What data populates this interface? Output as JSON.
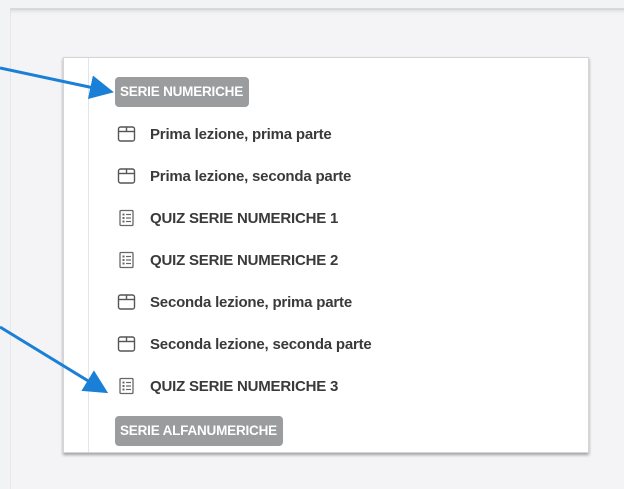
{
  "sections": [
    {
      "label": "SERIE NUMERICHE"
    },
    {
      "label": "SERIE ALFANUMERICHE"
    }
  ],
  "items": [
    {
      "label": "Prima lezione, prima parte",
      "icon": "lesson-icon"
    },
    {
      "label": "Prima lezione, seconda parte",
      "icon": "lesson-icon"
    },
    {
      "label": "QUIZ SERIE NUMERICHE 1",
      "icon": "quiz-icon"
    },
    {
      "label": "QUIZ SERIE NUMERICHE 2",
      "icon": "quiz-icon"
    },
    {
      "label": "Seconda lezione, prima parte",
      "icon": "lesson-icon"
    },
    {
      "label": "Seconda lezione, seconda parte",
      "icon": "lesson-icon"
    },
    {
      "label": "QUIZ SERIE NUMERICHE 3",
      "icon": "quiz-icon"
    }
  ],
  "colors": {
    "arrow": "#1a7fd6",
    "section_bg": "#9b9c9e",
    "item_text": "#3a3a3a"
  }
}
